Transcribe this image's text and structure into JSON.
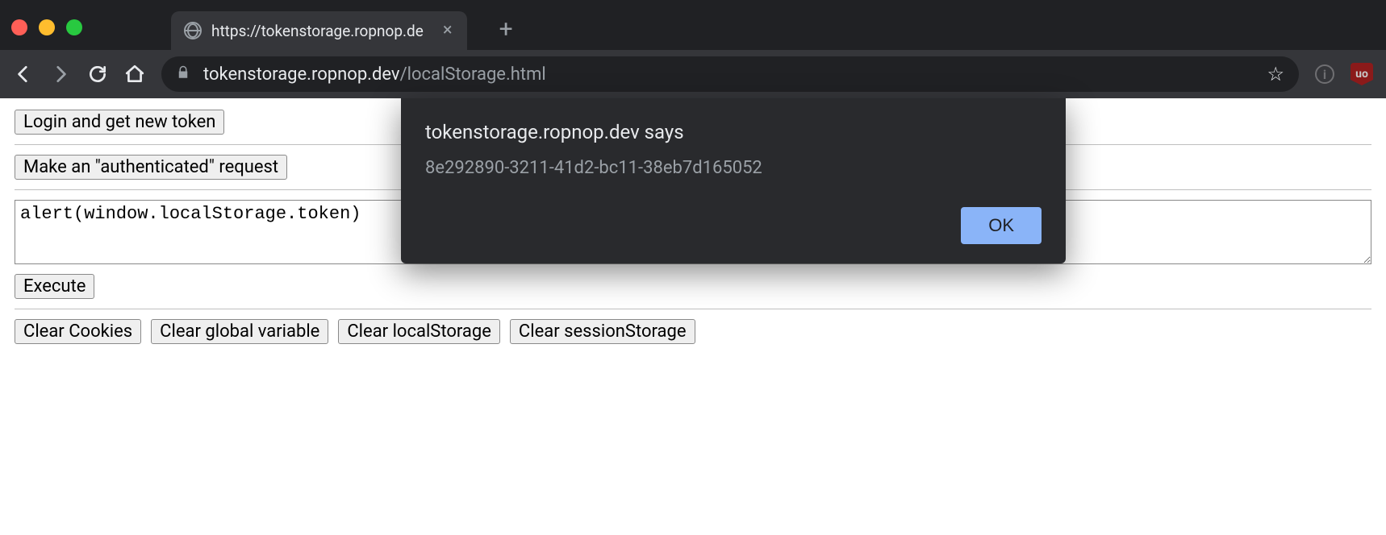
{
  "browser": {
    "tab_title": "https://tokenstorage.ropnop.de",
    "url_domain": "tokenstorage.ropnop.dev",
    "url_path": "/localStorage.html"
  },
  "page": {
    "login_btn": "Login and get new token",
    "auth_btn": "Make an \"authenticated\" request",
    "textarea_value": "alert(window.localStorage.token)",
    "execute_btn": "Execute",
    "clear": {
      "cookies": "Clear Cookies",
      "global": "Clear global variable",
      "local": "Clear localStorage",
      "session": "Clear sessionStorage"
    }
  },
  "alert": {
    "origin": "tokenstorage.ropnop.dev says",
    "message": "8e292890-3211-41d2-bc11-38eb7d165052",
    "ok": "OK"
  }
}
